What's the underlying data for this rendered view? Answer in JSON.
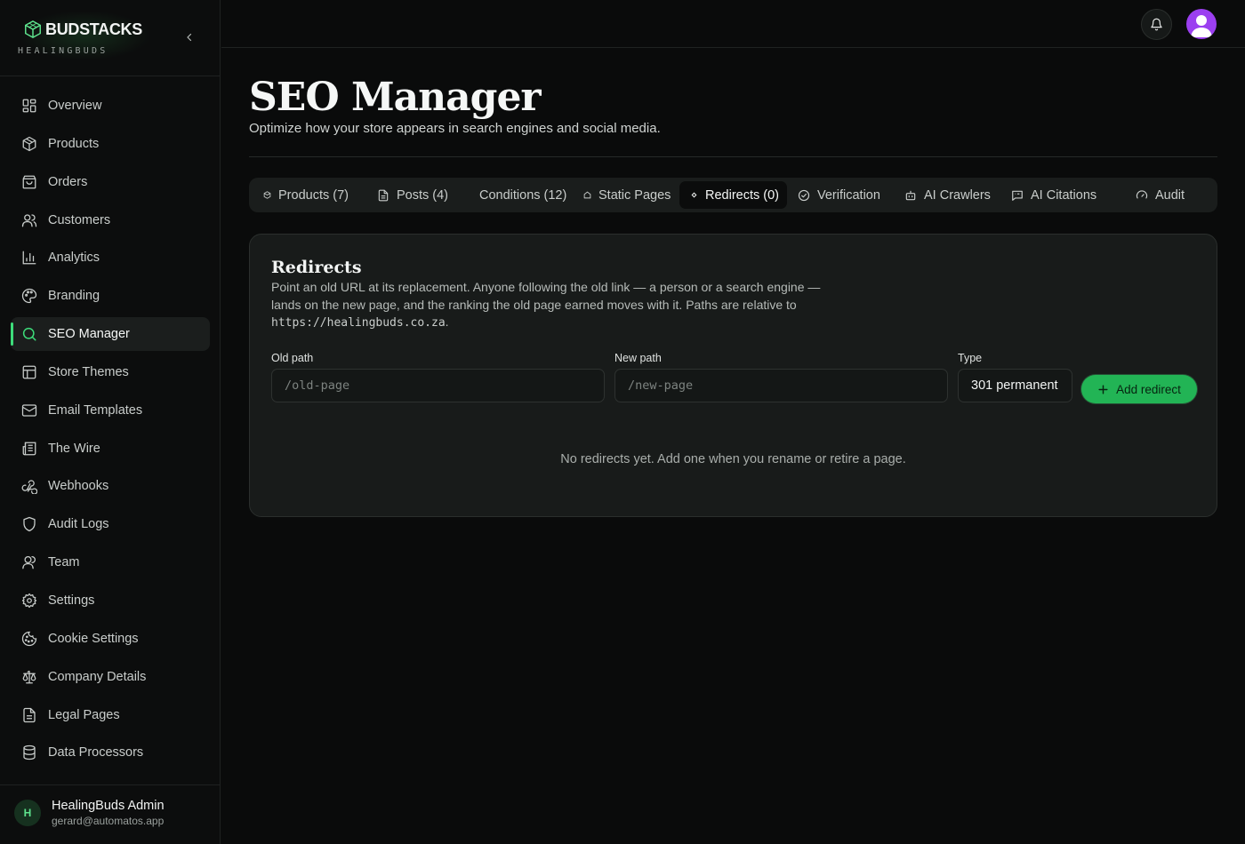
{
  "brand": {
    "name": "BUDSTACKS",
    "subtitle": "HEALINGBUDS"
  },
  "sidebar": {
    "items": [
      {
        "label": "Overview",
        "icon": "layout-grid-icon"
      },
      {
        "label": "Products",
        "icon": "package-icon"
      },
      {
        "label": "Orders",
        "icon": "shopping-bag-icon"
      },
      {
        "label": "Customers",
        "icon": "users-icon"
      },
      {
        "label": "Analytics",
        "icon": "bar-chart-icon"
      },
      {
        "label": "Branding",
        "icon": "palette-icon"
      },
      {
        "label": "SEO Manager",
        "icon": "search-icon",
        "active": true
      },
      {
        "label": "Store Themes",
        "icon": "layout-template-icon"
      },
      {
        "label": "Email Templates",
        "icon": "mail-icon"
      },
      {
        "label": "The Wire",
        "icon": "newspaper-icon"
      },
      {
        "label": "Webhooks",
        "icon": "webhook-icon"
      },
      {
        "label": "Audit Logs",
        "icon": "shield-icon"
      },
      {
        "label": "Team",
        "icon": "user-icon"
      },
      {
        "label": "Settings",
        "icon": "gear-icon"
      },
      {
        "label": "Cookie Settings",
        "icon": "cookie-icon"
      },
      {
        "label": "Company Details",
        "icon": "scale-icon"
      },
      {
        "label": "Legal Pages",
        "icon": "file-text-icon"
      },
      {
        "label": "Data Processors",
        "icon": "database-icon"
      }
    ]
  },
  "user": {
    "initial": "H",
    "name": "HealingBuds Admin",
    "email": "gerard@automatos.app"
  },
  "page": {
    "title": "SEO Manager",
    "subtitle": "Optimize how your store appears in search engines and social media."
  },
  "tabs": [
    {
      "label": "Products (7)",
      "icon": "package-icon"
    },
    {
      "label": "Posts (4)",
      "icon": "file-text-icon"
    },
    {
      "label": "Conditions (12)",
      "icon": ""
    },
    {
      "label": "Static Pages",
      "icon": "home-icon"
    },
    {
      "label": "Redirects (0)",
      "icon": "dot-icon",
      "active": true
    },
    {
      "label": "Verification",
      "icon": "check-circle-icon"
    },
    {
      "label": "AI Crawlers",
      "icon": "bot-icon"
    },
    {
      "label": "AI Citations",
      "icon": "message-square-icon"
    },
    {
      "label": "Audit",
      "icon": "gauge-icon"
    }
  ],
  "redirects": {
    "title": "Redirects",
    "description": "Point an old URL at its replacement. Anyone following the old link — a person or a search engine — lands on the new page, and the ranking the old page earned moves with it. Paths are relative to ",
    "base_url": "https://healingbuds.co.za",
    "description_end": ".",
    "old_path_label": "Old path",
    "old_path_placeholder": "/old-page",
    "new_path_label": "New path",
    "new_path_placeholder": "/new-page",
    "type_label": "Type",
    "type_value": "301 permanent",
    "add_button": "Add redirect",
    "empty_text": "No redirects yet. Add one when you rename or retire a page."
  },
  "colors": {
    "accent": "#3ddc7a",
    "button": "#22b455",
    "avatar": "#9b3ff0"
  }
}
